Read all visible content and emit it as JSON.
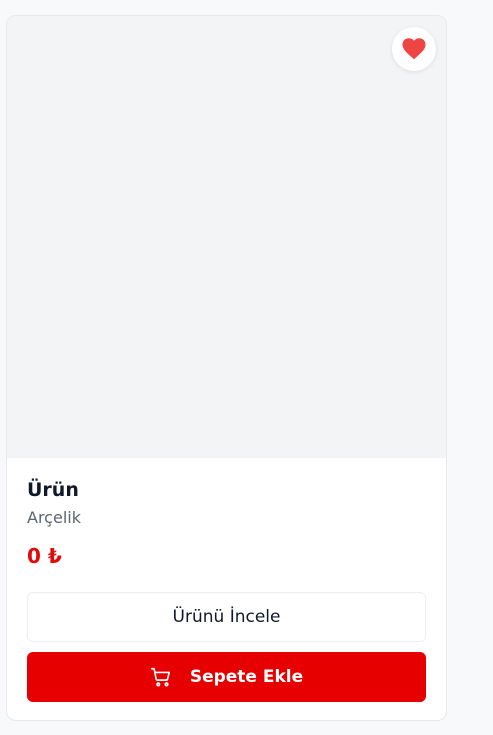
{
  "product": {
    "name": "Ürün",
    "brand": "Arçelik",
    "price": "0 ₺",
    "favorite": true
  },
  "actions": {
    "inspect_label": "Ürünü İncele",
    "add_to_cart_label": "Sepete Ekle"
  },
  "icons": {
    "favorite": "heart-icon",
    "cart": "shopping-cart-icon"
  },
  "colors": {
    "accent": "#e60000",
    "price": "#e10a0a",
    "heart": "#ef4444",
    "image_placeholder": "#f3f4f6"
  }
}
